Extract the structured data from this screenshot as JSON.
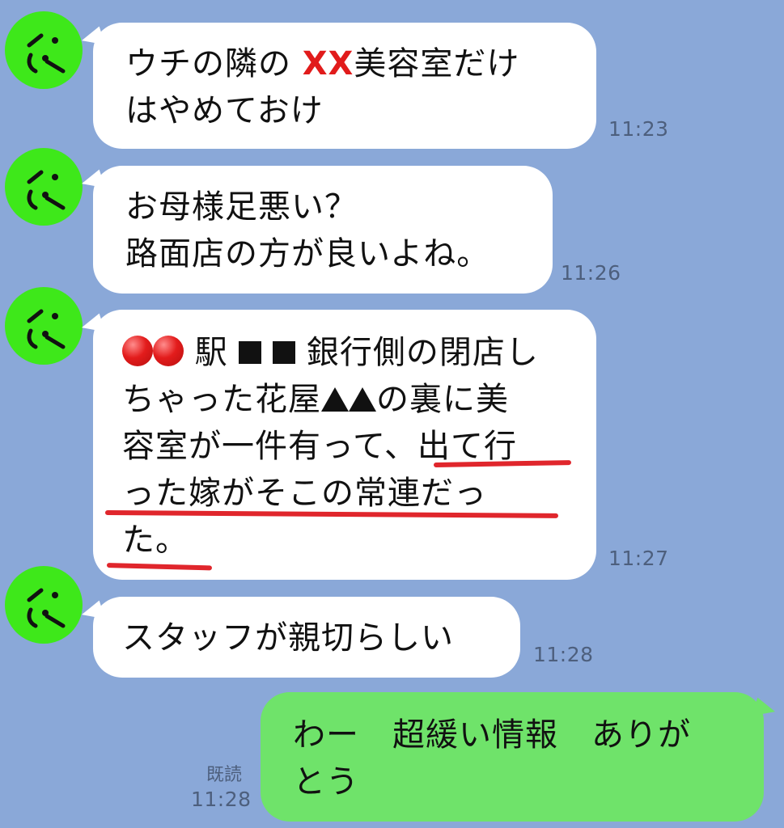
{
  "chat": {
    "messages": [
      {
        "sender": "other",
        "avatar_icon": "sad-face-icon",
        "lines": [
          "ウチの隣の XX美容室だけ",
          "はやめておけ"
        ],
        "time": "11:23"
      },
      {
        "sender": "other",
        "avatar_icon": "sad-face-icon",
        "lines": [
          "お母様足悪い？",
          "路面店の方が良いよね。"
        ],
        "time": "11:26"
      },
      {
        "sender": "other",
        "avatar_icon": "sad-face-icon",
        "lines": [
          "●● 駅 ■■ 銀行側の閉店し",
          "ちゃった花屋▲▲の裏に美",
          "容室が一件有って、出て行",
          "った嫁がそこの常連だっ",
          "た。"
        ],
        "time": "11:27"
      },
      {
        "sender": "other",
        "avatar_icon": "sad-face-icon",
        "lines": [
          "スタッフが親切らしい"
        ],
        "time": "11:28"
      },
      {
        "sender": "self",
        "lines": [
          "わー　超緩い情報　ありが",
          "とう"
        ],
        "read_label": "既読",
        "time": "11:28"
      }
    ]
  },
  "colors": {
    "background": "#8aa8d8",
    "incoming_bubble": "#ffffff",
    "outgoing_bubble": "#6fe36a",
    "avatar": "#3ee81a",
    "redaction_red": "#e11b1b",
    "underline_red": "#e0262c"
  }
}
